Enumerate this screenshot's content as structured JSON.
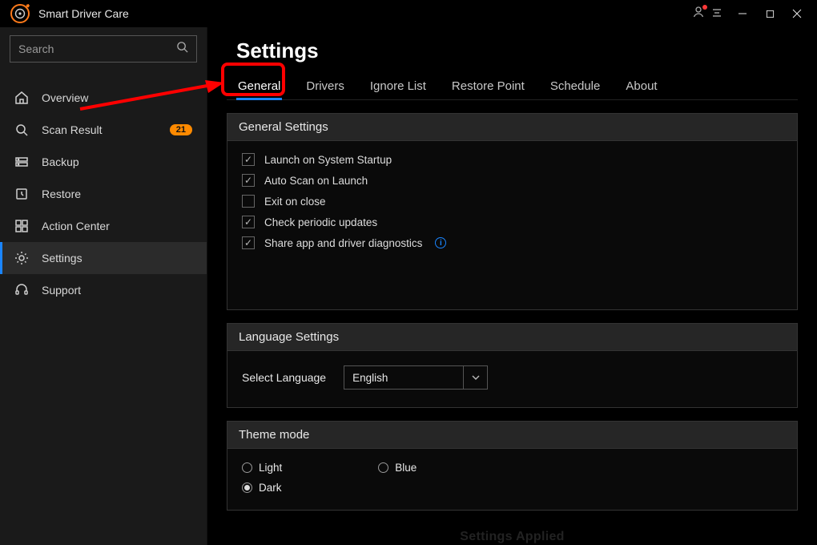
{
  "app_title": "Smart Driver Care",
  "search": {
    "placeholder": "Search"
  },
  "sidebar": {
    "items": [
      {
        "label": "Overview"
      },
      {
        "label": "Scan Result",
        "badge": "21"
      },
      {
        "label": "Backup"
      },
      {
        "label": "Restore"
      },
      {
        "label": "Action Center"
      },
      {
        "label": "Settings"
      },
      {
        "label": "Support"
      }
    ]
  },
  "main": {
    "title": "Settings",
    "tabs": [
      {
        "label": "General"
      },
      {
        "label": "Drivers"
      },
      {
        "label": "Ignore List"
      },
      {
        "label": "Restore Point"
      },
      {
        "label": "Schedule"
      },
      {
        "label": "About"
      }
    ],
    "general_panel": {
      "title": "General Settings",
      "options": [
        {
          "label": "Launch on System Startup",
          "checked": true
        },
        {
          "label": "Auto Scan on Launch",
          "checked": true
        },
        {
          "label": "Exit on close",
          "checked": false
        },
        {
          "label": "Check periodic updates",
          "checked": true
        },
        {
          "label": "Share app and driver diagnostics",
          "checked": true,
          "info": true
        }
      ]
    },
    "language_panel": {
      "title": "Language Settings",
      "select_label": "Select Language",
      "selected": "English"
    },
    "theme_panel": {
      "title": "Theme mode",
      "options": {
        "light": "Light",
        "blue": "Blue",
        "dark": "Dark"
      },
      "selected": "dark"
    },
    "status": "Settings Applied"
  }
}
